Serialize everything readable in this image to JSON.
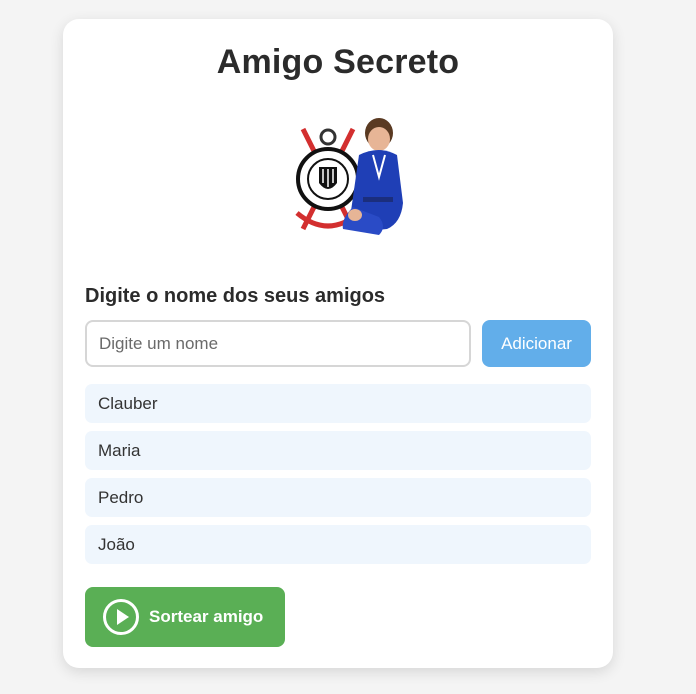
{
  "app": {
    "title": "Amigo Secreto"
  },
  "hero": {
    "image": "corinthians-crest-and-boy-in-blue-gi",
    "alt": ""
  },
  "form": {
    "label": "Digite o nome dos seus amigos",
    "input_placeholder": "Digite um nome",
    "input_value": "",
    "add_button_label": "Adicionar"
  },
  "friends": [
    {
      "name": "Clauber"
    },
    {
      "name": "Maria"
    },
    {
      "name": "Pedro"
    },
    {
      "name": "João"
    }
  ],
  "draw": {
    "button_label": "Sortear amigo",
    "icon": "play-circle-icon"
  },
  "colors": {
    "background": "#f4f4f4",
    "card": "#ffffff",
    "add_button": "#62aeea",
    "draw_button": "#5aaf55",
    "list_item_bg": "#eff6fd",
    "text": "#2b2b2b"
  }
}
